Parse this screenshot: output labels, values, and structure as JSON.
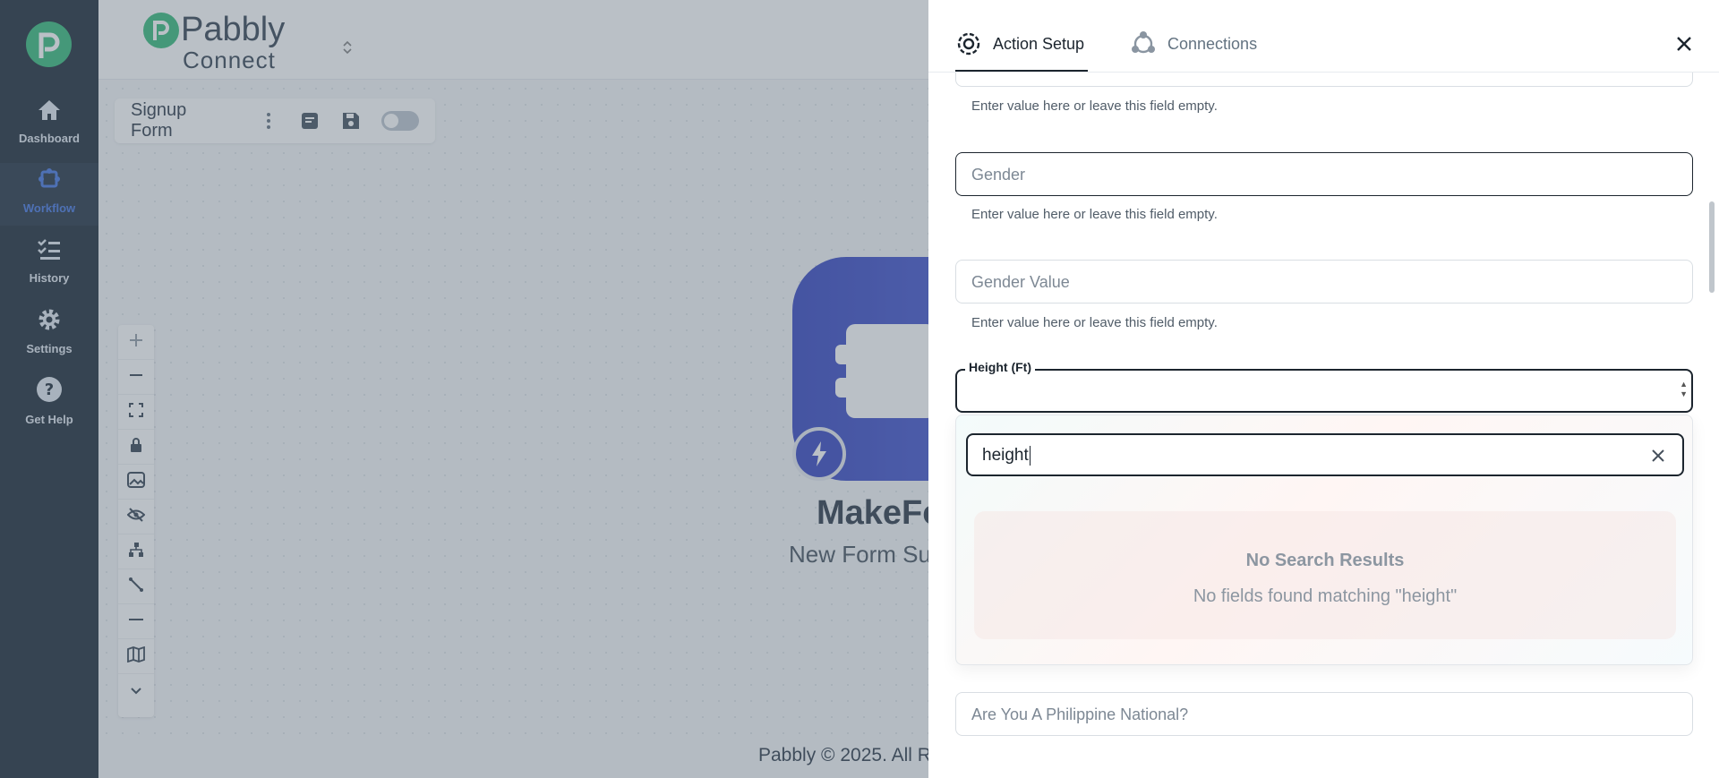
{
  "sidebar": {
    "items": [
      {
        "label": "Dashboard",
        "icon": "home-icon"
      },
      {
        "label": "Workflow",
        "icon": "workflow-icon"
      },
      {
        "label": "History",
        "icon": "history-icon"
      },
      {
        "label": "Settings",
        "icon": "gear-icon"
      },
      {
        "label": "Get Help",
        "icon": "help-icon"
      }
    ],
    "active_index": 1
  },
  "header": {
    "logo_line1": "Pabbly",
    "logo_line2": "Connect"
  },
  "workflow": {
    "name": "Signup Form"
  },
  "node": {
    "app_name": "MakeFo",
    "trigger": "New Form Su"
  },
  "footer": {
    "text": "Pabbly © 2025. All R"
  },
  "panel": {
    "tabs": [
      {
        "label": "Action Setup",
        "active": true
      },
      {
        "label": "Connections",
        "active": false
      }
    ],
    "fields": [
      {
        "placeholder": "",
        "helper": "Enter value here or leave this field empty."
      },
      {
        "placeholder": "Gender",
        "helper": "Enter value here or leave this field empty."
      },
      {
        "placeholder": "Gender Value",
        "helper": "Enter value here or leave this field empty."
      }
    ],
    "focused_field": {
      "label": "Height (Ft)",
      "value": ""
    },
    "dropdown": {
      "search_value": "height",
      "empty_title": "No Search Results",
      "empty_message": "No fields found matching \"height\""
    },
    "next_field": {
      "placeholder": "Are You A Philippine National?"
    }
  },
  "colors": {
    "sidebar_bg": "#0f1e2d",
    "brand_green": "#2bb673",
    "accent_blue": "#3b6fe0",
    "node_blue": "#2a3bbd"
  }
}
